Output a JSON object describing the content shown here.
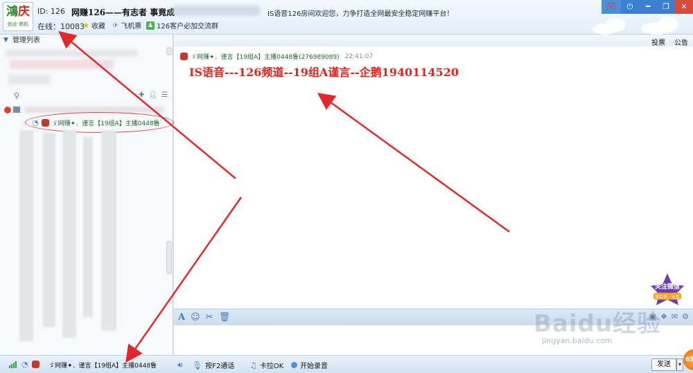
{
  "header": {
    "logo": {
      "mark_left": "鴻",
      "mark_right": "庆",
      "subtitle": "创业·商机"
    },
    "room_id": "ID: 126",
    "room_name": "网赚126——有志者 事竟成",
    "welcome": "IS语音126房间欢迎您，力争打造全网最安全稳定网赚平台！",
    "online": "在线：10083",
    "links": [
      {
        "label": "收藏",
        "icon": "star-icon"
      },
      {
        "label": "飞机票",
        "icon": "plane-icon"
      },
      {
        "label": "126客户必加交流群",
        "icon": "group-icon"
      }
    ]
  },
  "left_panel": {
    "header": "管理列表",
    "host_nick": "ゞ网赚✦．谨言【19组A】主播0448鲁"
  },
  "chat": {
    "header_votes": "投票",
    "header_notice": "公告",
    "message": {
      "sender": "ゞ网赚✦．谨言【19组A】主播0448鲁(276989089)",
      "time": "22:41:07",
      "text": "IS语音---126频道--19组A谨言--企鹅1940114520"
    },
    "wechat_badge": {
      "line1": "关注微信",
      "line2": "送会员 · 元宝"
    }
  },
  "statusbar": {
    "nick": "ゞ网赚✦．谨言【19组A】主播0448鲁",
    "press_f2": "按F2通话",
    "karaoke": "卡拉OK",
    "record": "开始录音",
    "send": "发送",
    "orange_ball": "65"
  },
  "watermark": {
    "logo": "Baidu经验",
    "url": "jingyan.baidu.com"
  },
  "colors": {
    "accent": "#3b7fcf",
    "message_red": "#e5231b",
    "nick_green": "#23692f",
    "arrow_red": "#e2282c"
  }
}
